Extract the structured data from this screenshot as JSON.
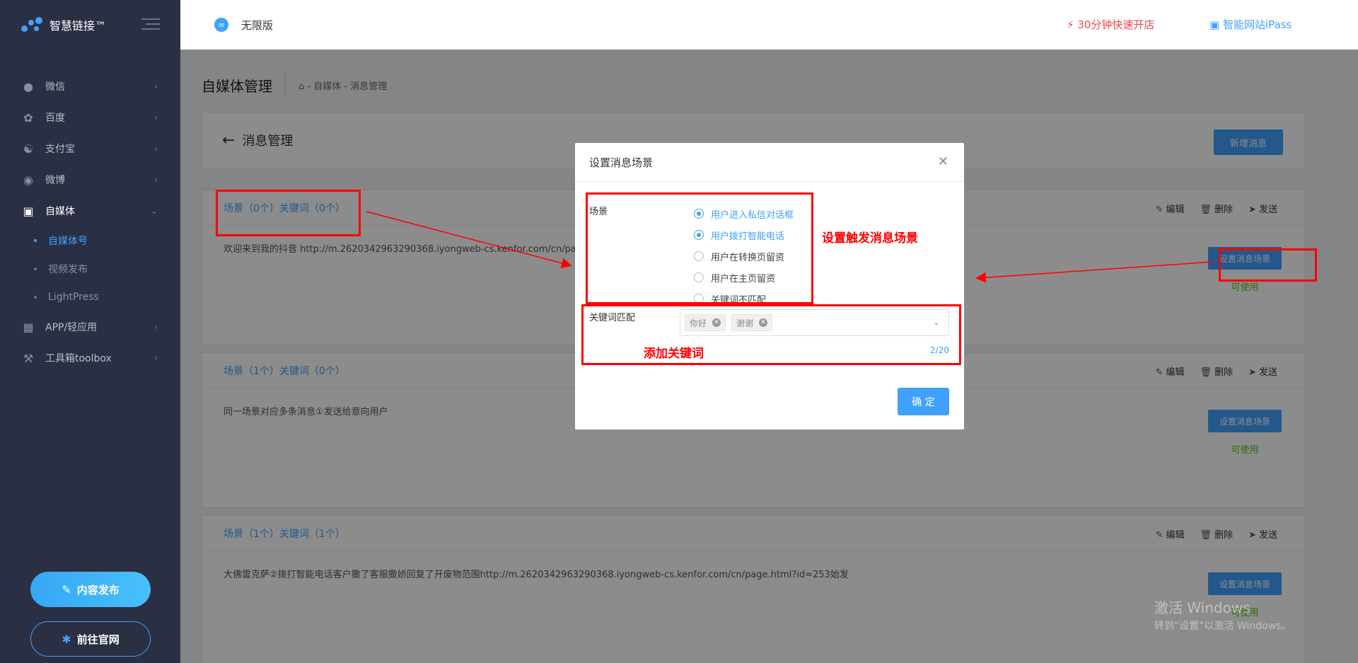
{
  "brand": {
    "name": "智慧链接™"
  },
  "sidebar": {
    "items": [
      {
        "label": "微信",
        "icon": "wechat-icon"
      },
      {
        "label": "百度",
        "icon": "paw-icon"
      },
      {
        "label": "支付宝",
        "icon": "alipay-icon"
      },
      {
        "label": "微博",
        "icon": "weibo-icon"
      },
      {
        "label": "自媒体",
        "icon": "camera-icon"
      },
      {
        "label": "APP/轻应用",
        "icon": "grid-icon"
      },
      {
        "label": "工具箱toolbox",
        "icon": "wrench-icon"
      }
    ],
    "sub_items": [
      {
        "label": "自媒体号"
      },
      {
        "label": "视频发布"
      },
      {
        "label": "LightPress"
      }
    ],
    "publish_btn": "内容发布",
    "site_btn": "前往官网"
  },
  "topbar": {
    "version": "无限版",
    "quick_open": "30分钟快速开店",
    "ipass": "智能网站iPass"
  },
  "page": {
    "title": "自媒体管理",
    "breadcrumb": "自媒体 - 消息管理",
    "back_title": "消息管理",
    "add_btn": "新增消息"
  },
  "messages": [
    {
      "title": "场景（0个）关键词（0个）",
      "body": "欢迎来到我的抖音 http://m.2620342963290368.iyongweb-cs.kenfor.com/cn/page",
      "status": "可使用"
    },
    {
      "title": "场景（1个）关键词（0个）",
      "body": "同一场景对应多条消息①发送给意向用户",
      "status": "可使用"
    },
    {
      "title": "场景（1个）关键词（1个）",
      "body": "大佛雷克萨②拨打智能电话客户撒了客服撒娇回复了开废物范围http://m.2620342963290368.iyongweb-cs.kenfor.com/cn/page.html?id=253始发",
      "status": "可使用"
    }
  ],
  "actions": {
    "edit": "编辑",
    "delete": "删除",
    "send": "发送",
    "scene_btn": "设置消息场景"
  },
  "dialog": {
    "title": "设置消息场景",
    "scene_label": "场景",
    "options": [
      {
        "label": "用户进入私信对话框",
        "checked": true
      },
      {
        "label": "用户拨打智能电话",
        "checked": true
      },
      {
        "label": "用户在转换页留资",
        "checked": false
      },
      {
        "label": "用户在主页留资",
        "checked": false
      },
      {
        "label": "关键词不匹配",
        "checked": false
      }
    ],
    "kw_label": "关键词匹配",
    "tags": [
      {
        "label": "你好"
      },
      {
        "label": "谢谢"
      }
    ],
    "kw_count": "2/20",
    "ok_btn": "确 定"
  },
  "annotations": {
    "scene_note": "设置触发消息场景",
    "kw_note": "添加关键词"
  },
  "watermark": {
    "line1": "激活 Windows",
    "line2": "转到“设置”以激活 Windows。"
  },
  "colors": {
    "accent": "#3fa0ff",
    "sidebar": "#2b2f43",
    "annotation": "#ff0000",
    "success": "#52c41a",
    "danger": "#f5454a"
  }
}
